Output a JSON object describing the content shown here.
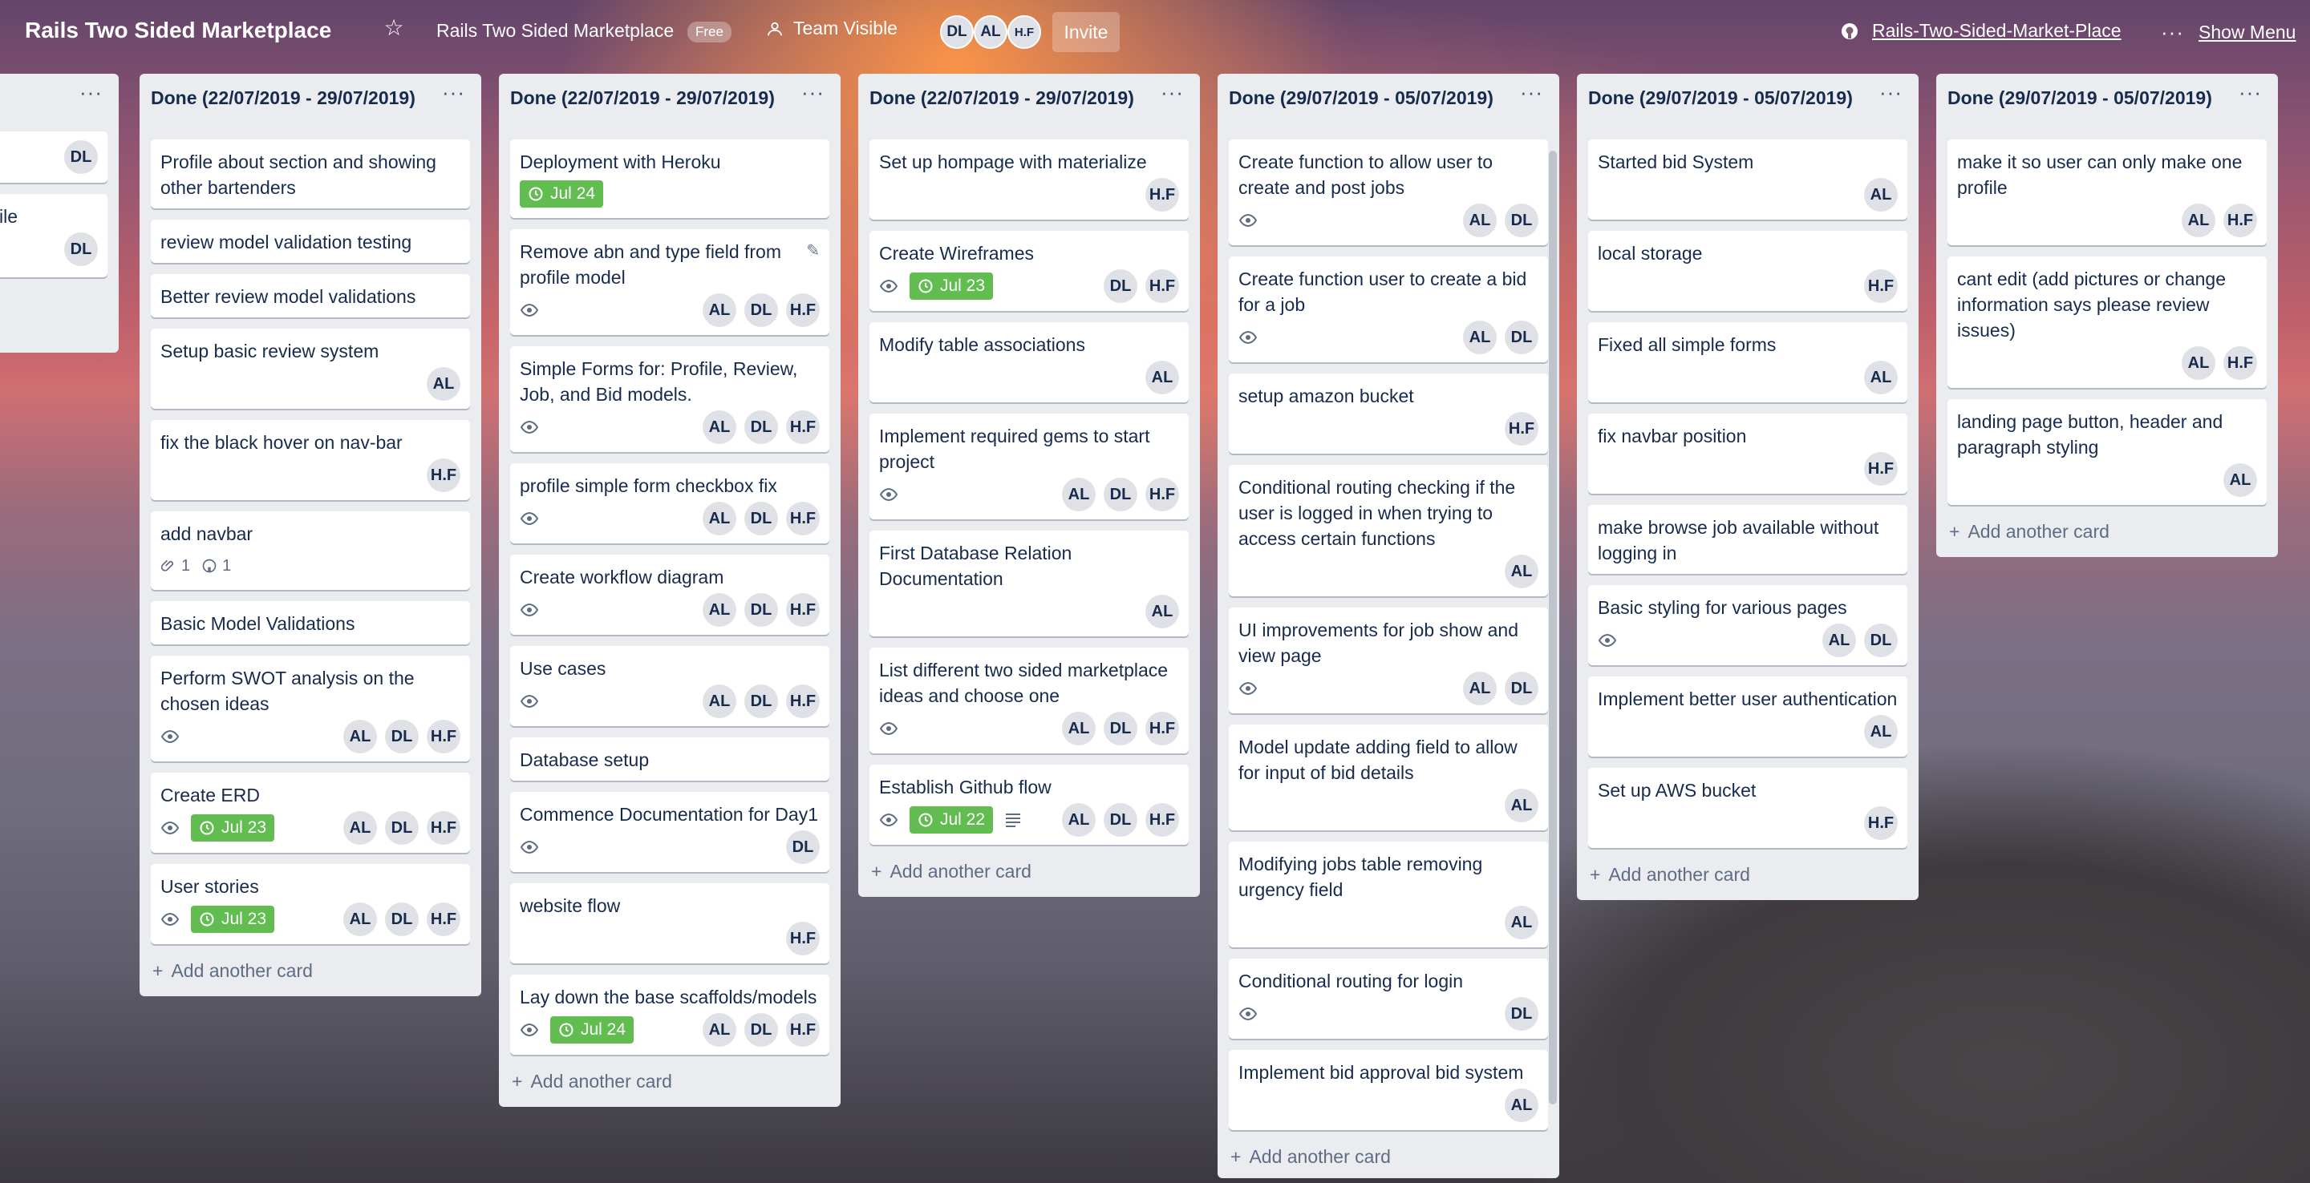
{
  "topbar": {
    "board_title": "Rails Two Sided Marketplace",
    "board_crumb": "Rails Two Sided Marketplace",
    "free_badge": "Free",
    "visibility": "Team Visible",
    "members": [
      "DL",
      "AL",
      "H.F"
    ],
    "invite": "Invite",
    "github_link": "Rails-Two-Sided-Market-Place",
    "show_menu": "Show Menu"
  },
  "add_card_label": "Add another card",
  "partial": {
    "cards": [
      {
        "title": "",
        "members": [
          "DL"
        ]
      },
      {
        "title": "ofile",
        "members": [
          "DL"
        ]
      }
    ]
  },
  "lists": [
    {
      "title": "Done (22/07/2019 - 29/07/2019)",
      "cards": [
        {
          "title": "Profile about section and showing other bartenders"
        },
        {
          "title": "review model validation testing"
        },
        {
          "title": "Better review model validations"
        },
        {
          "title": "Setup basic review system",
          "members": [
            "AL"
          ]
        },
        {
          "title": "fix the black hover on nav-bar",
          "members": [
            "H.F"
          ]
        },
        {
          "title": "add navbar",
          "attachments": "1",
          "github": "1"
        },
        {
          "title": "Basic Model Validations"
        },
        {
          "title": "Perform SWOT analysis on the chosen ideas",
          "watch": true,
          "members": [
            "AL",
            "DL",
            "H.F"
          ]
        },
        {
          "title": "Create ERD",
          "watch": true,
          "due": "Jul 23",
          "members": [
            "AL",
            "DL",
            "H.F"
          ]
        },
        {
          "title": "User stories",
          "watch": true,
          "due": "Jul 23",
          "members": [
            "AL",
            "DL",
            "H.F"
          ]
        }
      ]
    },
    {
      "title": "Done (22/07/2019 - 29/07/2019)",
      "cards": [
        {
          "title": "Deployment with Heroku",
          "due": "Jul 24"
        },
        {
          "title": "Remove abn and type field from profile model",
          "watch": true,
          "edit": true,
          "members": [
            "AL",
            "DL",
            "H.F"
          ]
        },
        {
          "title": "Simple Forms for: Profile, Review, Job, and Bid models.",
          "watch": true,
          "members": [
            "AL",
            "DL",
            "H.F"
          ]
        },
        {
          "title": "profile simple form checkbox fix",
          "watch": true,
          "members": [
            "AL",
            "DL",
            "H.F"
          ]
        },
        {
          "title": "Create workflow diagram",
          "watch": true,
          "members": [
            "AL",
            "DL",
            "H.F"
          ]
        },
        {
          "title": "Use cases",
          "watch": true,
          "members": [
            "AL",
            "DL",
            "H.F"
          ]
        },
        {
          "title": "Database setup"
        },
        {
          "title": "Commence Documentation for Day1",
          "watch": true,
          "members": [
            "DL"
          ]
        },
        {
          "title": "website flow",
          "members": [
            "H.F"
          ]
        },
        {
          "title": "Lay down the base scaffolds/models",
          "watch": true,
          "due": "Jul 24",
          "members": [
            "AL",
            "DL",
            "H.F"
          ]
        }
      ]
    },
    {
      "title": "Done (22/07/2019 - 29/07/2019)",
      "cards": [
        {
          "title": "Set up hompage with materialize",
          "members": [
            "H.F"
          ]
        },
        {
          "title": "Create Wireframes",
          "watch": true,
          "due": "Jul 23",
          "members": [
            "DL",
            "H.F"
          ]
        },
        {
          "title": "Modify table associations",
          "members": [
            "AL"
          ]
        },
        {
          "title": "Implement required gems to start project",
          "watch": true,
          "members": [
            "AL",
            "DL",
            "H.F"
          ]
        },
        {
          "title": "First Database Relation Documentation",
          "members": [
            "AL"
          ]
        },
        {
          "title": "List different two sided marketplace ideas and choose one",
          "watch": true,
          "members": [
            "AL",
            "DL",
            "H.F"
          ]
        },
        {
          "title": "Establish Github flow",
          "watch": true,
          "due": "Jul 22",
          "desc": true,
          "members": [
            "AL",
            "DL",
            "H.F"
          ]
        }
      ]
    },
    {
      "title": "Done (29/07/2019 - 05/07/2019)",
      "cards": [
        {
          "title": "Create function to allow user to create and post jobs",
          "watch": true,
          "members": [
            "AL",
            "DL"
          ]
        },
        {
          "title": "Create function user to create a bid for a job",
          "watch": true,
          "members": [
            "AL",
            "DL"
          ]
        },
        {
          "title": "setup amazon bucket",
          "members": [
            "H.F"
          ]
        },
        {
          "title": "Conditional routing checking if the user is logged in when trying to access certain functions",
          "members": [
            "AL"
          ]
        },
        {
          "title": "UI improvements for job show and view page",
          "watch": true,
          "members": [
            "AL",
            "DL"
          ]
        },
        {
          "title": "Model update adding field to allow for input of bid details",
          "members": [
            "AL"
          ]
        },
        {
          "title": "Modifying jobs table removing urgency field",
          "members": [
            "AL"
          ]
        },
        {
          "title": "Conditional routing for login",
          "watch": true,
          "members": [
            "DL"
          ]
        },
        {
          "title": "Implement bid approval bid system",
          "members": [
            "AL"
          ]
        }
      ]
    },
    {
      "title": "Done (29/07/2019 - 05/07/2019)",
      "cards": [
        {
          "title": "Started bid System",
          "members": [
            "AL"
          ]
        },
        {
          "title": "local storage",
          "members": [
            "H.F"
          ]
        },
        {
          "title": "Fixed all simple forms",
          "members": [
            "AL"
          ]
        },
        {
          "title": "fix navbar position",
          "members": [
            "H.F"
          ]
        },
        {
          "title": "make browse job available without logging in"
        },
        {
          "title": "Basic styling for various pages",
          "watch": true,
          "members": [
            "AL",
            "DL"
          ]
        },
        {
          "title": "Implement better user authentication",
          "members": [
            "AL"
          ]
        },
        {
          "title": "Set up AWS bucket",
          "members": [
            "H.F"
          ]
        }
      ]
    },
    {
      "title": "Done (29/07/2019 - 05/07/2019)",
      "cards": [
        {
          "title": "make it so user can only make one profile",
          "members": [
            "AL",
            "H.F"
          ]
        },
        {
          "title": "cant edit (add pictures or change information says please review issues)",
          "members": [
            "AL",
            "H.F"
          ]
        },
        {
          "title": "landing page button, header and paragraph styling",
          "members": [
            "AL"
          ]
        }
      ]
    }
  ]
}
